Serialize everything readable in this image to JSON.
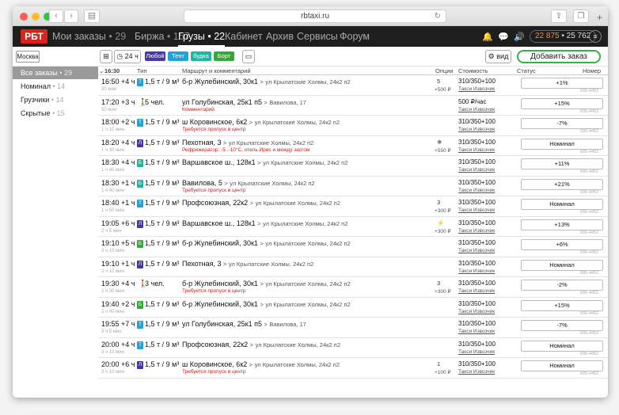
{
  "browser": {
    "url": "rbtaxi.ru",
    "tab_add": "+"
  },
  "nav": {
    "logo": "РБТ",
    "items": [
      {
        "label": "Мои заказы",
        "count": "• 29"
      },
      {
        "label": "Биржа",
        "count": "• 157"
      },
      {
        "label": "Грузы",
        "count": "• 22"
      },
      {
        "label": "Кабинет",
        "count": ""
      },
      {
        "label": "Архив",
        "count": ""
      },
      {
        "label": "Сервисы",
        "count": ""
      },
      {
        "label": "Форум",
        "count": ""
      }
    ],
    "balance_main": "22 875",
    "balance_sep": " • ",
    "balance_second": "25 762",
    "menu_icon": "≡"
  },
  "toolbar": {
    "city": "Москва",
    "timer_label": "24 ч",
    "tags": [
      {
        "label": "Любой",
        "color": "#4a35a8"
      },
      {
        "label": "Тент",
        "color": "#1fa3d8"
      },
      {
        "label": "будка",
        "color": "#21b5a0"
      },
      {
        "label": "Борт",
        "color": "#36a83a"
      }
    ],
    "view_label": "вид",
    "add_order": "Добавить заказ"
  },
  "sidebar": {
    "items": [
      {
        "label": "Все заказы",
        "count": "• 29"
      },
      {
        "label": "Номинал",
        "count": "• 14"
      },
      {
        "label": "Грузчики",
        "count": "• 14"
      },
      {
        "label": "Скрытые",
        "count": "• 15"
      }
    ]
  },
  "table": {
    "headers": {
      "time": "16:30",
      "type": "Тип",
      "route": "Маршрут и комментарий",
      "options": "Опции",
      "cost": "Стоимость",
      "status": "Статус",
      "number": "Номер"
    },
    "rows": [
      {
        "time": "16:50 +4 ч",
        "ago": "20 мин",
        "badge": "Т",
        "badge_color": "#1fa3d8",
        "person": "",
        "type": "1,5 т / 9 м³",
        "from": "б-р Жулебинский, 30к1",
        "to": "ул Крылатские Холмы, 24к2 п2",
        "comment": "",
        "opt": "5",
        "opt_price": "+500 ₽",
        "cost": "310/350+100",
        "service": "Такси Извозчик",
        "status": "+1%",
        "num": "695-4452"
      },
      {
        "time": "17:20 +3 ч",
        "ago": "50 мин",
        "badge": "",
        "badge_color": "",
        "person": "🚶",
        "type": "5 чел.",
        "from": "ул Голубинская, 25к1 п5",
        "to": "Вавилова, 17",
        "comment": "Комментарий",
        "opt": "",
        "opt_price": "",
        "cost": "500 ₽/час",
        "service": "Такси Извозчик",
        "status": "+15%",
        "num": "695-4452"
      },
      {
        "time": "18:00 +2 ч",
        "ago": "1 ч 10 мин",
        "badge": "Т",
        "badge_color": "#1fa3d8",
        "person": "",
        "type": "1,5 т / 9 м³",
        "from": "ш Коровинское, 6к2",
        "to": "ул Крылатские Холмы, 24к2 п2",
        "comment": "Требуется пропуск в центр",
        "opt": "",
        "opt_price": "",
        "cost": "310/350+100",
        "service": "Такси Извозчик",
        "status": "-7%",
        "num": "695-4452"
      },
      {
        "time": "18:20 +4 ч",
        "ago": "1 ч 30 мин",
        "badge": "Л",
        "badge_color": "#4a35a8",
        "person": "",
        "type": "1,5 т / 9 м³",
        "from": "Пехотная, 3",
        "to": "ул Крылатские Холмы, 24к2 п2",
        "comment": "Рефрижератор: -5..-10°С, отель Ирис и между засгом",
        "opt": "❄",
        "opt_price": "+550 ₽",
        "cost": "310/350+100",
        "service": "Такси Извозчик",
        "status": "Номинал",
        "num": "695-4452"
      },
      {
        "time": "18:30 +4 ч",
        "ago": "1 ч 40 мин",
        "badge": "Б",
        "badge_color": "#21b5a0",
        "person": "",
        "type": "1,5 т / 9 м³",
        "from": "Варшавское ш., 128к1",
        "to": "ул Крылатские Холмы, 24к2 п2",
        "comment": "",
        "opt": "",
        "opt_price": "",
        "cost": "310/350+100",
        "service": "Такси Извозчик",
        "status": "+11%",
        "num": "695-4452"
      },
      {
        "time": "18:30 +1 ч",
        "ago": "1 ч 40 мин",
        "badge": "Б",
        "badge_color": "#21b5a0",
        "person": "",
        "type": "1,5 т / 9 м³",
        "from": "Вавилова, 5",
        "to": "ул Крылатские Холмы, 24к2 п2",
        "comment": "Требуется пропуск в центр",
        "opt": "",
        "opt_price": "",
        "cost": "310/350+100",
        "service": "Такси Извозчик",
        "status": "+21%",
        "num": "695-4452"
      },
      {
        "time": "18:40 +1 ч",
        "ago": "1 ч 50 мин",
        "badge": "Т",
        "badge_color": "#1fa3d8",
        "person": "",
        "type": "1,5 т / 9 м³",
        "from": "Профсоюзная, 22к2",
        "to": "ул Крылатские Холмы, 24к2 п2",
        "comment": "",
        "opt": "3",
        "opt_price": "+300 ₽",
        "cost": "310/350+100",
        "service": "Такси Извозчик",
        "status": "Номинал",
        "num": "695-4452"
      },
      {
        "time": "19:05 +6 ч",
        "ago": "2 ч 5 мин",
        "badge": "Л",
        "badge_color": "#4a35a8",
        "person": "",
        "type": "1,5 т / 9 м³",
        "from": "Варшавское ш., 128к1",
        "to": "ул Крылатские Холмы, 24к2 п2",
        "comment": "",
        "opt": "⚡",
        "opt_price": "+300 ₽",
        "cost": "310/350+100",
        "service": "Такси Извозчик",
        "status": "+13%",
        "num": "695-4452"
      },
      {
        "time": "19:10 +5 ч",
        "ago": "2 ч 10 мин",
        "badge": "Б",
        "badge_color": "#36a83a",
        "person": "",
        "type": "1,5 т / 9 м³",
        "from": "б-р Жулебинский, 30к1",
        "to": "ул Крылатские Холмы, 24к2 п2",
        "comment": "",
        "opt": "",
        "opt_price": "",
        "cost": "310/350+100",
        "service": "Такси Извозчик",
        "status": "+6%",
        "num": "695-4452"
      },
      {
        "time": "19:10 +1 ч",
        "ago": "2 ч 10 мин",
        "badge": "Л",
        "badge_color": "#4a35a8",
        "person": "",
        "type": "1,5 т / 9 м³",
        "from": "Пехотная, 3",
        "to": "ул Крылатские Холмы, 24к2 п2",
        "comment": "",
        "opt": "",
        "opt_price": "",
        "cost": "310/350+100",
        "service": "Такси Извозчик",
        "status": "Номинал",
        "num": "695-4452"
      },
      {
        "time": "19:30 +4 ч",
        "ago": "2 ч 30 мин",
        "badge": "",
        "badge_color": "",
        "person": "🚶",
        "type": "3 чел.",
        "from": "б-р Жулебинский, 30к1",
        "to": "ул Крылатские Холмы, 24к2 п2",
        "comment": "Требуется пропуск в центр",
        "opt": "3",
        "opt_price": "+300 ₽",
        "cost": "310/350+100",
        "service": "Такси Извозчик",
        "status": "-2%",
        "num": "695-4452"
      },
      {
        "time": "19:40 +2 ч",
        "ago": "2 ч 40 мин",
        "badge": "Б",
        "badge_color": "#36a83a",
        "person": "",
        "type": "1,5 т / 9 м³",
        "from": "б-р Жулебинский, 30к1",
        "to": "ул Крылатские Холмы, 24к2 п2",
        "comment": "",
        "opt": "",
        "opt_price": "",
        "cost": "310/350+100",
        "service": "Такси Извозчик",
        "status": "+15%",
        "num": "695-4452"
      },
      {
        "time": "19:55 +7 ч",
        "ago": "3 ч 5 мин",
        "badge": "Т",
        "badge_color": "#1fa3d8",
        "person": "",
        "type": "1,5 т / 9 м³",
        "from": "ул Голубинская, 25к1 п5",
        "to": "Вавилова, 17",
        "comment": "",
        "opt": "",
        "opt_price": "",
        "cost": "310/350+100",
        "service": "Такси Извозчик",
        "status": "-7%",
        "num": "695-4452"
      },
      {
        "time": "20:00 +4 ч",
        "ago": "3 ч 10 мин",
        "badge": "Т",
        "badge_color": "#1fa3d8",
        "person": "",
        "type": "1,5 т / 9 м³",
        "from": "Профсоюзная, 22к2",
        "to": "ул Крылатские Холмы, 24к2 п2",
        "comment": "",
        "opt": "",
        "opt_price": "",
        "cost": "310/350+100",
        "service": "Такси Извозчик",
        "status": "Номинал",
        "num": "695-4452"
      },
      {
        "time": "20:00 +6 ч",
        "ago": "3 ч 10 мин",
        "badge": "Л",
        "badge_color": "#4a35a8",
        "person": "",
        "type": "1,5 т / 9 м³",
        "from": "ш Коровинское, 6к2",
        "to": "ул Крылатские Холмы, 24к2 п2",
        "comment": "Требуется пропуск в центр",
        "opt": "1",
        "opt_price": "+100 ₽",
        "cost": "310/350+100",
        "service": "Такси Извозчик",
        "status": "Номинал",
        "num": "695-4452"
      }
    ]
  }
}
